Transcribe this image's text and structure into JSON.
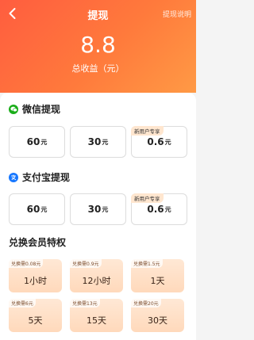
{
  "header": {
    "title": "提现",
    "rules_link": "提现说明",
    "total_amount": "8.8",
    "total_label": "总收益（元）"
  },
  "wechat": {
    "title": "微信提现",
    "options": [
      {
        "amount": "60",
        "unit": "元",
        "tag": ""
      },
      {
        "amount": "30",
        "unit": "元",
        "tag": ""
      },
      {
        "amount": "0.6",
        "unit": "元",
        "tag": "新用户专享"
      }
    ]
  },
  "alipay": {
    "title": "支付宝提现",
    "options": [
      {
        "amount": "60",
        "unit": "元",
        "tag": ""
      },
      {
        "amount": "30",
        "unit": "元",
        "tag": ""
      },
      {
        "amount": "0.6",
        "unit": "元",
        "tag": "新用户专享"
      }
    ]
  },
  "vip": {
    "title": "兑换会员特权",
    "items": [
      {
        "cost": "兑换需0.08元",
        "duration": "1小时"
      },
      {
        "cost": "兑换需0.9元",
        "duration": "12小时"
      },
      {
        "cost": "兑换需1.5元",
        "duration": "1天"
      },
      {
        "cost": "兑换需6元",
        "duration": "5天"
      },
      {
        "cost": "兑换需13元",
        "duration": "15天"
      },
      {
        "cost": "兑换需20元",
        "duration": "30天"
      }
    ]
  },
  "colors": {
    "header_start": "#ff5d3f",
    "header_end": "#ff9a45",
    "wechat_green": "#1aad19",
    "alipay_blue": "#1677ff",
    "vip_bg": "#ffd9bb"
  }
}
